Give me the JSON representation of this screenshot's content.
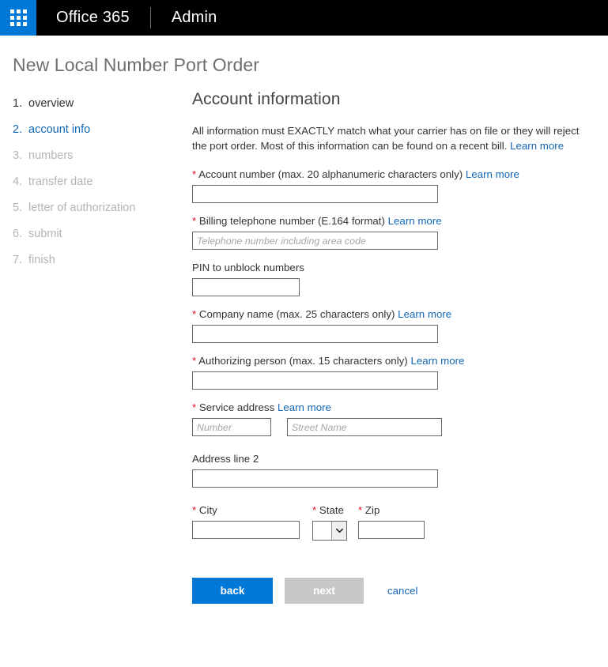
{
  "suite_bar": {
    "waffle_icon": "app-launcher-waffle-icon",
    "brand": "Office 365",
    "app_name": "Admin"
  },
  "page": {
    "title": "New Local Number Port Order"
  },
  "wizard": {
    "steps": [
      {
        "num": "1.",
        "label": "overview",
        "state": "done"
      },
      {
        "num": "2.",
        "label": "account info",
        "state": "active"
      },
      {
        "num": "3.",
        "label": "numbers",
        "state": "todo"
      },
      {
        "num": "4.",
        "label": "transfer date",
        "state": "todo"
      },
      {
        "num": "5.",
        "label": "letter of authorization",
        "state": "todo"
      },
      {
        "num": "6.",
        "label": "submit",
        "state": "todo"
      },
      {
        "num": "7.",
        "label": "finish",
        "state": "todo"
      }
    ]
  },
  "form": {
    "section_title": "Account information",
    "intro_text": "All information must EXACTLY match what your carrier has on file or they will reject the port order. Most of this information can be found on a recent bill.",
    "intro_link": "Learn more",
    "learn_more": "Learn more",
    "required_marker": "*",
    "fields": {
      "account_number": {
        "label": "Account number (max. 20 alphanumeric characters only)",
        "value": "",
        "placeholder": ""
      },
      "billing_phone": {
        "label": "Billing telephone number (E.164 format)",
        "value": "",
        "placeholder": "Telephone number including area code"
      },
      "pin": {
        "label": "PIN to unblock numbers",
        "value": "",
        "placeholder": ""
      },
      "company_name": {
        "label": "Company name (max. 25 characters only)",
        "value": "",
        "placeholder": ""
      },
      "authorizing_person": {
        "label": "Authorizing person (max. 15 characters only)",
        "value": "",
        "placeholder": ""
      },
      "service_address": {
        "label": "Service address",
        "number_value": "",
        "number_placeholder": "Number",
        "street_value": "",
        "street_placeholder": "Street Name"
      },
      "address_line_2": {
        "label": "Address line 2",
        "value": "",
        "placeholder": ""
      },
      "city": {
        "label": "City",
        "value": "",
        "placeholder": ""
      },
      "state": {
        "label": "State",
        "value": ""
      },
      "zip": {
        "label": "Zip",
        "value": "",
        "placeholder": ""
      }
    }
  },
  "actions": {
    "back": "back",
    "next": "next",
    "cancel": "cancel"
  },
  "colors": {
    "accent_blue": "#0078d7",
    "link_blue": "#1267b5",
    "required_red": "#e81123",
    "disabled_gray": "#c8c8c8",
    "suite_bar_black": "#000000"
  }
}
